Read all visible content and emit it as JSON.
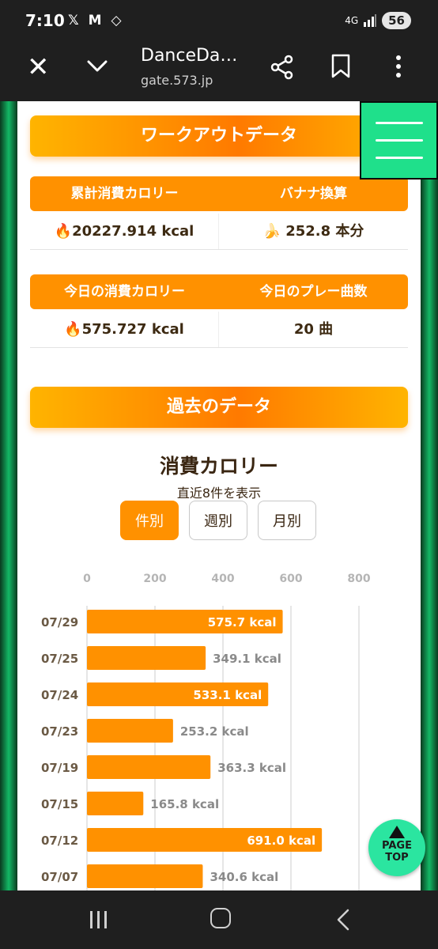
{
  "status_bar": {
    "time": "7:10",
    "left_icons": "𝕏 M ◇",
    "network": "4G",
    "battery": "56"
  },
  "browser": {
    "title": "DanceDa…",
    "url": "gate.573.jp"
  },
  "workout": {
    "header": "ワークアウトデータ",
    "total_label": "累計消費カロリー",
    "banana_label": "バナナ換算",
    "total_value": "🔥20227.914 kcal",
    "banana_value": "🍌 252.8 本分",
    "today_cal_label": "今日の消費カロリー",
    "today_plays_label": "今日のプレー曲数",
    "today_cal_value": "🔥575.727 kcal",
    "today_plays_value": "20 曲"
  },
  "past": {
    "header": "過去のデータ",
    "chart_title": "消費カロリー",
    "chart_subtitle": "直近8件を表示",
    "tabs": [
      {
        "label": "件別",
        "active": true
      },
      {
        "label": "週別",
        "active": false
      },
      {
        "label": "月別",
        "active": false
      }
    ]
  },
  "chart_data": {
    "type": "bar",
    "orientation": "horizontal",
    "categories": [
      "07/29",
      "07/25",
      "07/24",
      "07/23",
      "07/19",
      "07/15",
      "07/12",
      "07/07"
    ],
    "values": [
      575.7,
      349.1,
      533.1,
      253.2,
      363.3,
      165.8,
      691.0,
      340.6
    ],
    "labels": [
      "575.7 kcal",
      "349.1 kcal",
      "533.1 kcal",
      "253.2 kcal",
      "363.3 kcal",
      "165.8 kcal",
      "691.0 kcal",
      "340.6 kcal"
    ],
    "xticks": [
      0,
      200,
      400,
      600,
      800
    ],
    "xlim": [
      0,
      800
    ],
    "grid": true,
    "bar_color": "#ff9100"
  },
  "page_top": {
    "line1": "PAGE",
    "line2": "TOP"
  },
  "colors": {
    "accent": "#ff9100",
    "menu": "#1fe08b",
    "pagetop": "#2be5a0"
  }
}
